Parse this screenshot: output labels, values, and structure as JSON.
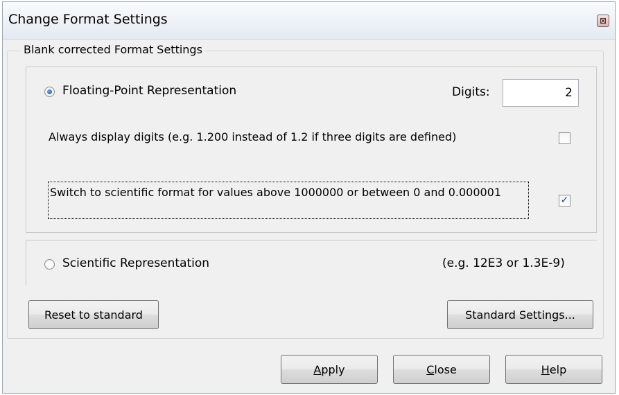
{
  "window": {
    "title": "Change Format Settings",
    "close_glyph": "⊠"
  },
  "group": {
    "legend": "Blank corrected Format Settings"
  },
  "floating": {
    "radio_label": "Floating-Point Representation",
    "selected": true,
    "digits_label": "Digits:",
    "digits_value": "2",
    "always_display_label": "Always display digits (e.g. 1.200 instead of 1.2 if three digits are defined)",
    "always_display_checked": false,
    "switch_scientific_label": "Switch to scientific format for values above 1000000 or between 0 and 0.000001",
    "switch_scientific_checked": true,
    "check_glyph": "✓"
  },
  "scientific": {
    "radio_label": "Scientific Representation",
    "selected": false,
    "example": "(e.g. 12E3 or 1.3E-9)"
  },
  "buttons": {
    "reset": "Reset to standard",
    "standard_settings": "Standard Settings...",
    "apply_mnemonic": "A",
    "apply_rest": "pply",
    "close_mnemonic": "C",
    "close_rest": "lose",
    "help_mnemonic": "H",
    "help_rest": "elp"
  }
}
